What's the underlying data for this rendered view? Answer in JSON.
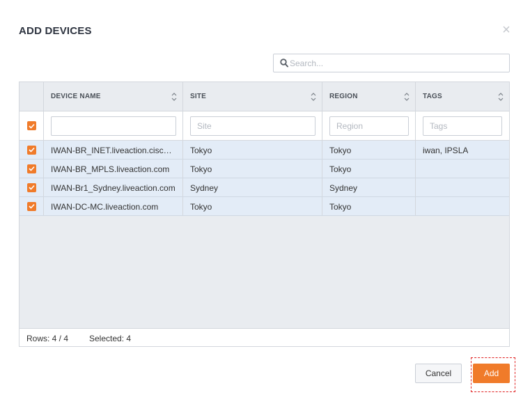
{
  "dialog": {
    "title": "ADD DEVICES",
    "close_icon": "close-icon"
  },
  "search": {
    "placeholder": "Search...",
    "value": ""
  },
  "table": {
    "columns": [
      {
        "label": "DEVICE NAME",
        "sortable": true
      },
      {
        "label": "SITE",
        "sortable": true
      },
      {
        "label": "REGION",
        "sortable": true
      },
      {
        "label": "TAGS",
        "sortable": true
      }
    ],
    "filters": {
      "device_name": {
        "placeholder": "",
        "value": ""
      },
      "site": {
        "placeholder": "Site",
        "value": ""
      },
      "region": {
        "placeholder": "Region",
        "value": ""
      },
      "tags": {
        "placeholder": "Tags",
        "value": ""
      }
    },
    "select_all_checked": true,
    "rows": [
      {
        "checked": true,
        "device_name": "IWAN-BR_INET.liveaction.cisco....",
        "site": "Tokyo",
        "region": "Tokyo",
        "tags": "iwan, IPSLA"
      },
      {
        "checked": true,
        "device_name": "IWAN-BR_MPLS.liveaction.com",
        "site": "Tokyo",
        "region": "Tokyo",
        "tags": ""
      },
      {
        "checked": true,
        "device_name": "IWAN-Br1_Sydney.liveaction.com",
        "site": "Sydney",
        "region": "Sydney",
        "tags": ""
      },
      {
        "checked": true,
        "device_name": "IWAN-DC-MC.liveaction.com",
        "site": "Tokyo",
        "region": "Tokyo",
        "tags": ""
      }
    ],
    "footer": {
      "rows_text": "Rows: 4 / 4",
      "selected_text": "Selected: 4"
    }
  },
  "buttons": {
    "cancel_label": "Cancel",
    "add_label": "Add"
  },
  "colors": {
    "accent": "#f07b2a",
    "selected_row": "#e3ecf7",
    "header_bg": "#e9ecf0"
  }
}
